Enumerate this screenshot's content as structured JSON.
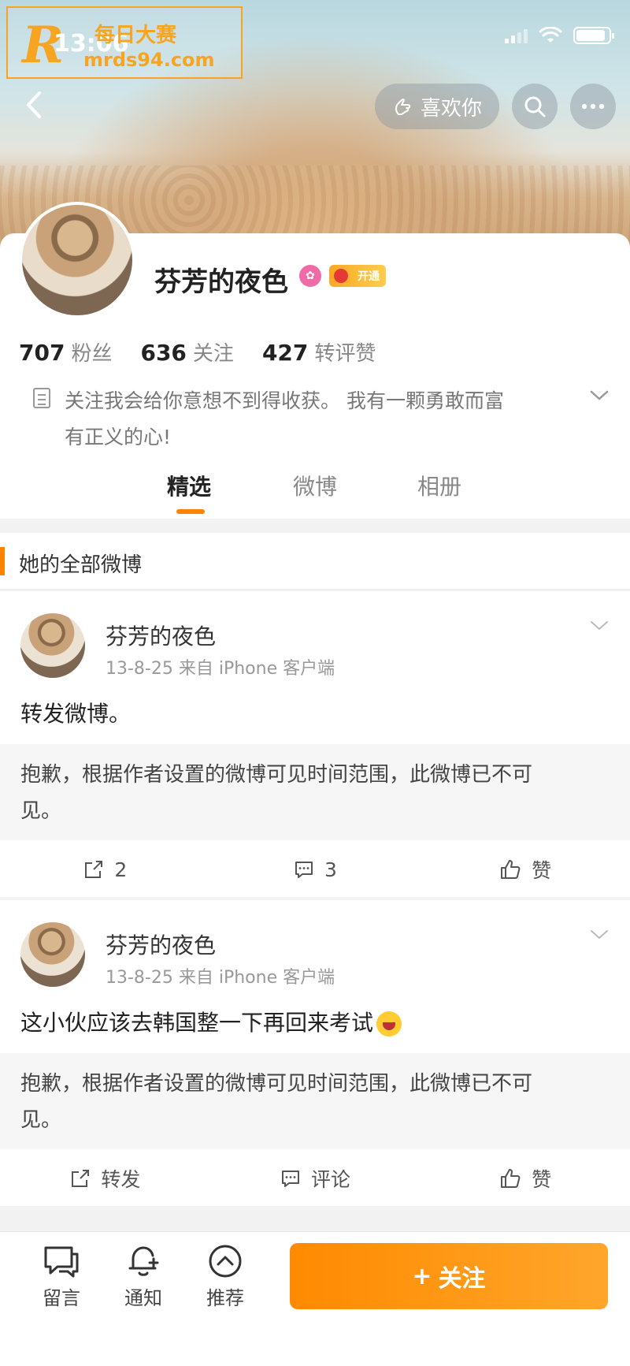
{
  "status_bar": {
    "time": "13:06",
    "watermark_line1": "每日大赛",
    "watermark_line2": "mrds94.com",
    "watermark_logo": "R"
  },
  "top_nav": {
    "like_label": "喜欢你"
  },
  "profile": {
    "name": "芬芳的夜色",
    "vip_label": "开通",
    "stats": [
      {
        "value": "707",
        "label": "粉丝"
      },
      {
        "value": "636",
        "label": "关注"
      },
      {
        "value": "427",
        "label": "转评赞"
      }
    ],
    "bio_line1": "关注我会给你意想不到得收获。 我有一颗勇敢而富",
    "bio_line2": "有正义的心!"
  },
  "tabs": [
    {
      "label": "精选",
      "active": true
    },
    {
      "label": "微博",
      "active": false
    },
    {
      "label": "相册",
      "active": false
    }
  ],
  "section_title": "她的全部微博",
  "posts": [
    {
      "author": "芬芳的夜色",
      "meta": "13-8-25  来自 iPhone 客户端",
      "text": "转发微博。",
      "quote_line1": "抱歉，根据作者设置的微博可见时间范围，此微博已不可",
      "quote_line2": "见。",
      "actions": {
        "repost": "2",
        "comment": "3",
        "like": "赞"
      }
    },
    {
      "author": "芬芳的夜色",
      "meta": "13-8-25  来自 iPhone 客户端",
      "text": "这小伙应该去韩国整一下再回来考试",
      "quote_line1": "抱歉，根据作者设置的微博可见时间范围，此微博已不可",
      "quote_line2": "见。",
      "actions": {
        "repost": "转发",
        "comment": "评论",
        "like": "赞"
      }
    }
  ],
  "bottom_bar": {
    "message": "留言",
    "notify": "通知",
    "recommend": "推荐",
    "follow": "关注",
    "follow_plus": "+"
  },
  "colors": {
    "accent": "#ff8200",
    "follow_button": "#ff9a1a",
    "verify": "#f06aa6"
  }
}
